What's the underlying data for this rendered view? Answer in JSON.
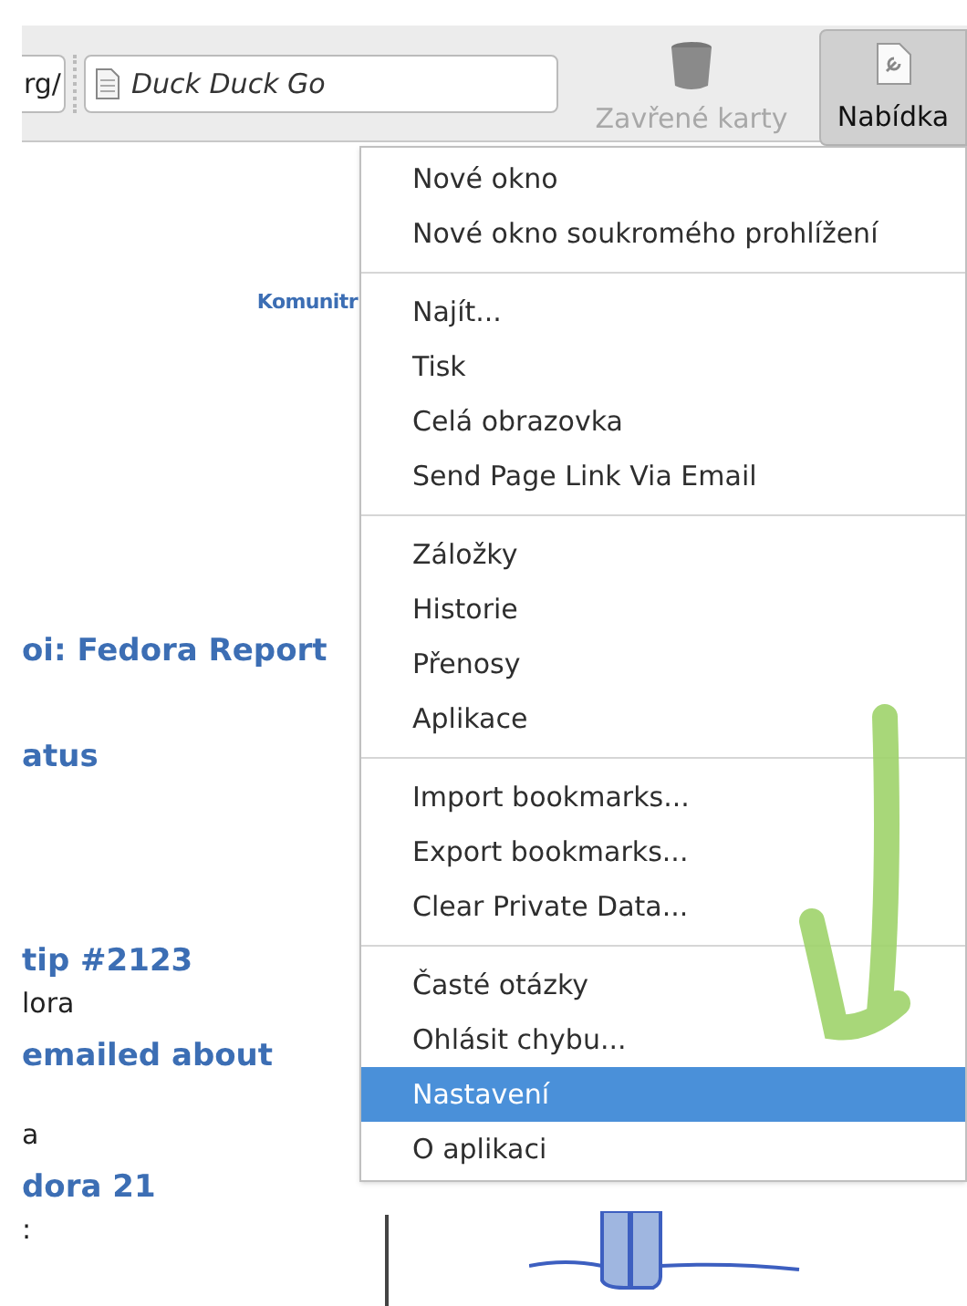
{
  "toolbar": {
    "url_tail": "rg/",
    "search": {
      "value": "Duck Duck Go"
    },
    "closed_tabs": {
      "label": "Zavřené karty",
      "disabled": true
    },
    "menu_button": {
      "label": "Nabídka",
      "pressed": true
    }
  },
  "page": {
    "links": [
      {
        "text": "Komunitr",
        "kind": "nav"
      },
      {
        "text": "oi: Fedora Report",
        "kind": "heading"
      },
      {
        "text": "atus",
        "kind": "heading"
      },
      {
        "text": "tip #2123",
        "kind": "heading"
      },
      {
        "text": "lora",
        "kind": "plain"
      },
      {
        "text": "emailed about",
        "kind": "heading"
      },
      {
        "text": "a",
        "kind": "plain"
      },
      {
        "text": "dora 21",
        "kind": "heading"
      },
      {
        "text": ":",
        "kind": "plain"
      }
    ]
  },
  "menu": {
    "groups": [
      [
        {
          "label": "Nové okno",
          "selected": false
        },
        {
          "label": "Nové okno soukromého prohlížení",
          "selected": false
        }
      ],
      [
        {
          "label": "Najít...",
          "selected": false
        },
        {
          "label": "Tisk",
          "selected": false
        },
        {
          "label": "Celá obrazovka",
          "selected": false
        },
        {
          "label": "Send Page Link Via Email",
          "selected": false
        }
      ],
      [
        {
          "label": "Záložky",
          "selected": false
        },
        {
          "label": "Historie",
          "selected": false
        },
        {
          "label": "Přenosy",
          "selected": false
        },
        {
          "label": "Aplikace",
          "selected": false
        }
      ],
      [
        {
          "label": "Import bookmarks...",
          "selected": false
        },
        {
          "label": "Export bookmarks...",
          "selected": false
        },
        {
          "label": "Clear Private Data...",
          "selected": false
        }
      ],
      [
        {
          "label": "Časté otázky",
          "selected": false
        },
        {
          "label": "Ohlásit chybu...",
          "selected": false
        },
        {
          "label": "Nastavení",
          "selected": true
        },
        {
          "label": "O aplikaci",
          "selected": false
        }
      ]
    ]
  }
}
